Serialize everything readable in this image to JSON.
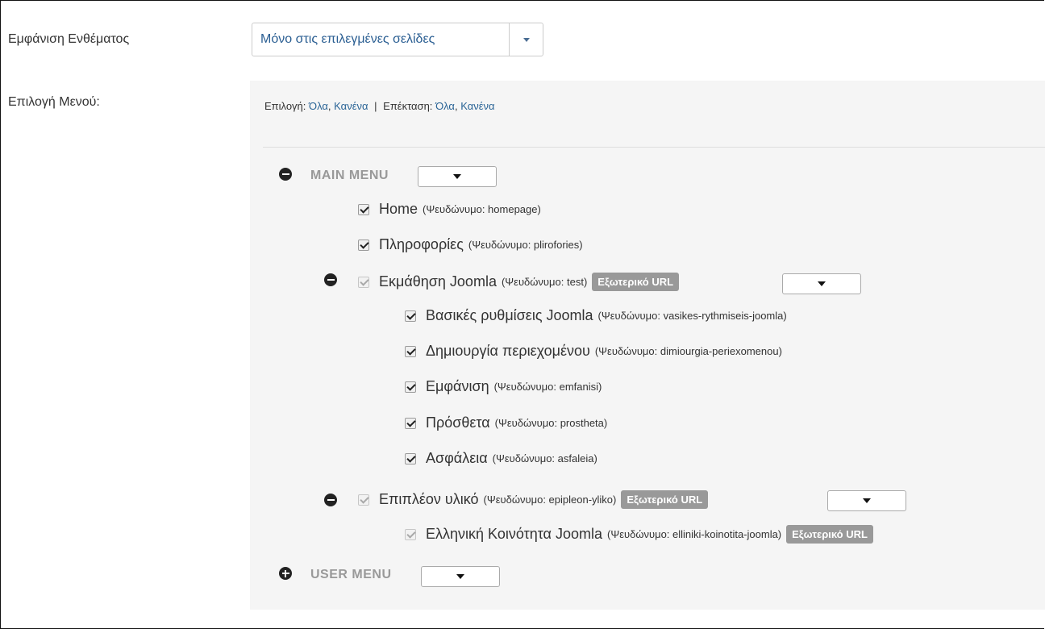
{
  "module_display": {
    "label": "Εμφάνιση Ενθέματος",
    "value": "Μόνο στις επιλεγμένες σελίδες"
  },
  "menu_selection": {
    "label": "Επιλογή Μενού:",
    "toolbar": {
      "select_label": "Επιλογή:",
      "select_all": "Όλα",
      "select_none": "Κανένα",
      "separator": "|",
      "expand_label": "Επέκταση:",
      "expand_all": "Όλα",
      "expand_none": "Κανένα",
      "comma": ","
    }
  },
  "menus": [
    {
      "title": "MAIN MENU",
      "expanded": true,
      "items": [
        {
          "title": "Home",
          "alias": "(Ψευδώνυμο: homepage)",
          "checked": true
        },
        {
          "title": "Πληροφορίες",
          "alias": "(Ψευδώνυμο: plirofories)",
          "checked": true
        },
        {
          "title": "Εκμάθηση Joomla",
          "alias": "(Ψευδώνυμο: test)",
          "checked": true,
          "disabled": true,
          "badge": "Εξωτερικό URL",
          "expanded": true,
          "children": [
            {
              "title": "Βασικές ρυθμίσεις Joomla",
              "alias": "(Ψευδώνυμο: vasikes-rythmiseis-joomla)",
              "checked": true
            },
            {
              "title": "Δημιουργία περιεχομένου",
              "alias": "(Ψευδώνυμο: dimiourgia-periexomenou)",
              "checked": true
            },
            {
              "title": "Εμφάνιση",
              "alias": "(Ψευδώνυμο: emfanisi)",
              "checked": true
            },
            {
              "title": "Πρόσθετα",
              "alias": "(Ψευδώνυμο: prostheta)",
              "checked": true
            },
            {
              "title": "Ασφάλεια",
              "alias": "(Ψευδώνυμο: asfaleia)",
              "checked": true
            }
          ]
        },
        {
          "title": "Επιπλέον υλικό",
          "alias": "(Ψευδώνυμο: epipleon-yliko)",
          "checked": true,
          "disabled": true,
          "badge": "Εξωτερικό URL",
          "expanded": true,
          "children": [
            {
              "title": "Ελληνική Κοινότητα Joomla",
              "alias": "(Ψευδώνυμο: elliniki-koinotita-joomla)",
              "checked": true,
              "disabled": true,
              "badge": "Εξωτερικό URL"
            }
          ]
        }
      ]
    },
    {
      "title": "USER MENU",
      "expanded": false,
      "items": []
    }
  ],
  "colors": {
    "link": "#2a6496",
    "select_text": "#2a5e92",
    "badge_bg": "#999999",
    "panel_bg": "#f5f5f5",
    "menu_title": "#999999"
  },
  "icons": {
    "collapse": "minus-circle-icon",
    "expand": "plus-circle-icon",
    "dropdown": "caret-down-icon",
    "checkbox": "checkbox-checked-icon"
  }
}
